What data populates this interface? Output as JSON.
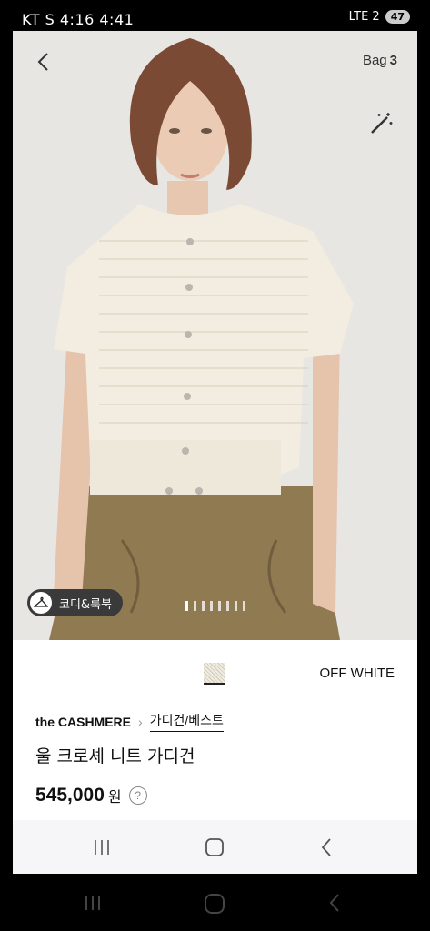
{
  "status": {
    "left": "KT S 4:16 4:41",
    "right": "LTE 2",
    "battery": "47"
  },
  "header": {
    "bag_label": "Bag",
    "bag_count": "3"
  },
  "hero": {
    "coordi_label": "코디&룩북",
    "dots_count": 8,
    "active_dot": 0
  },
  "product": {
    "color_name": "OFF WHITE",
    "brand": "the CASHMERE",
    "category": "가디건/베스트",
    "title": "울 크로셰 니트 가디건",
    "price": "545,000",
    "currency": "원",
    "help": "?"
  },
  "icons": [
    "back-icon",
    "magic-wand-icon",
    "hanger-icon",
    "chevron-right-icon",
    "help-icon",
    "recents-icon",
    "home-icon",
    "back-nav-icon"
  ]
}
